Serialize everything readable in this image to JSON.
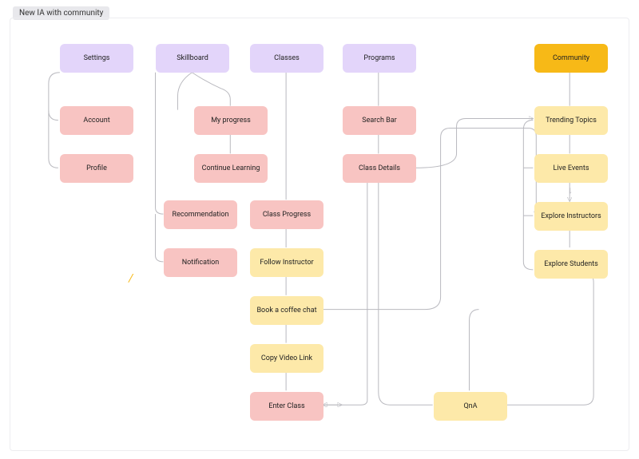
{
  "title": "New IA with community",
  "nodes": {
    "settings": "Settings",
    "skillboard": "Skillboard",
    "classes": "Classes",
    "programs": "Programs",
    "community": "Community",
    "account": "Account",
    "profile": "Profile",
    "my_progress": "My progress",
    "continue_learning": "Continue Learning",
    "recommendation": "Recommendation",
    "notification": "Notification",
    "class_progress": "Class Progress",
    "follow_instructor": "Follow Instructor",
    "book_coffee": "Book a coffee chat",
    "copy_video": "Copy Video Link",
    "enter_class": "Enter Class",
    "search_bar": "Search Bar",
    "class_details": "Class Details",
    "qna": "QnA",
    "trending": "Trending Topics",
    "live_events": "Live Events",
    "explore_instr": "Explore Instructors",
    "explore_stud": "Explore Students"
  },
  "colors": {
    "purple": "#e3d5fa",
    "pink": "#f8c4c2",
    "yellow": "#fde9a9",
    "amber": "#f7b917",
    "edge": "#b9b9bf"
  },
  "decor": {
    "slash": "/"
  }
}
